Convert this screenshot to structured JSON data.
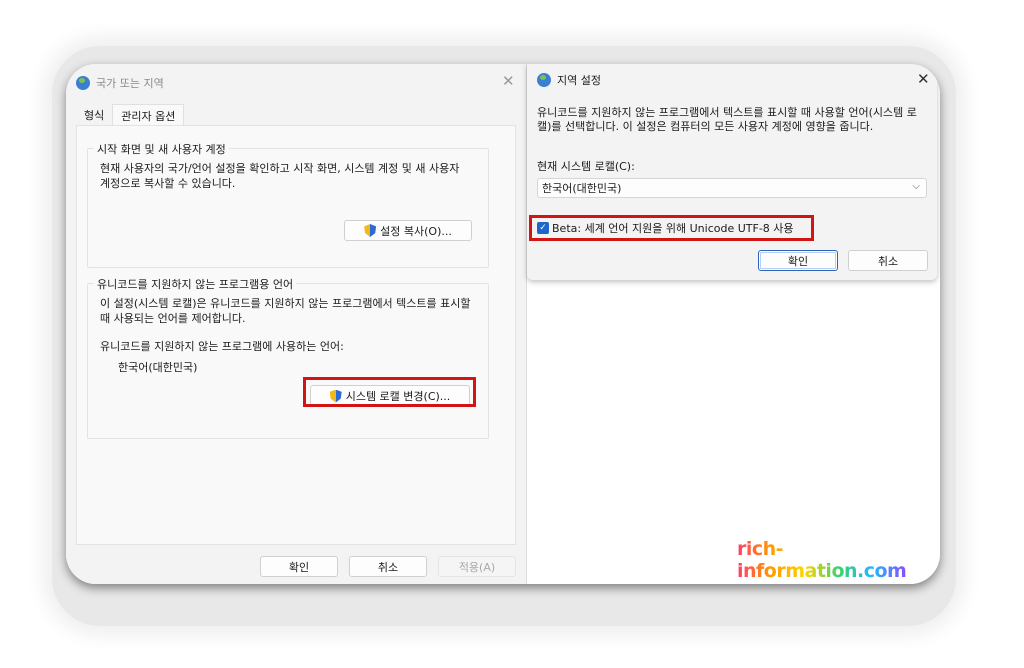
{
  "left_window": {
    "title": "국가 또는 지역",
    "close_glyph": "✕",
    "tabs": [
      "형식",
      "관리자 옵션"
    ],
    "group_start": {
      "legend": "시작 화면 및 새 사용자 계정",
      "text": "현재 사용자의 국가/언어 설정을 확인하고 시작 화면, 시스템 계정 및 새 사용자 계정으로 복사할 수 있습니다.",
      "button": "설정 복사(O)..."
    },
    "group_unicode": {
      "legend": "유니코드를 지원하지 않는 프로그램용 언어",
      "text": "이 설정(시스템 로캘)은 유니코드를 지원하지 않는 프로그램에서 텍스트를 표시할 때 사용되는 언어를 제어합니다.",
      "current_label": "유니코드를 지원하지 않는 프로그램에 사용하는 언어:",
      "current_value": "한국어(대한민국)",
      "button": "시스템 로캘 변경(C)..."
    },
    "footer": {
      "ok": "확인",
      "cancel": "취소",
      "apply": "적용(A)"
    }
  },
  "dialog": {
    "title": "지역 설정",
    "close_glyph": "✕",
    "description": "유니코드를 지원하지 않는 프로그램에서 텍스트를 표시할 때 사용할 언어(시스템 로캘)를 선택합니다. 이 설정은 컴퓨터의 모든 사용자 계정에 영향을 줍니다.",
    "locale_label": "현재 시스템 로캘(C):",
    "locale_value": "한국어(대한민국)",
    "checkbox_label": "Beta: 세계 언어 지원을 위해 Unicode UTF-8 사용",
    "checkbox_checked": true,
    "ok": "확인",
    "cancel": "취소"
  },
  "watermark": "rich-information.com",
  "colors": {
    "highlight_box": "#d21414",
    "accent": "#1e66c9"
  }
}
